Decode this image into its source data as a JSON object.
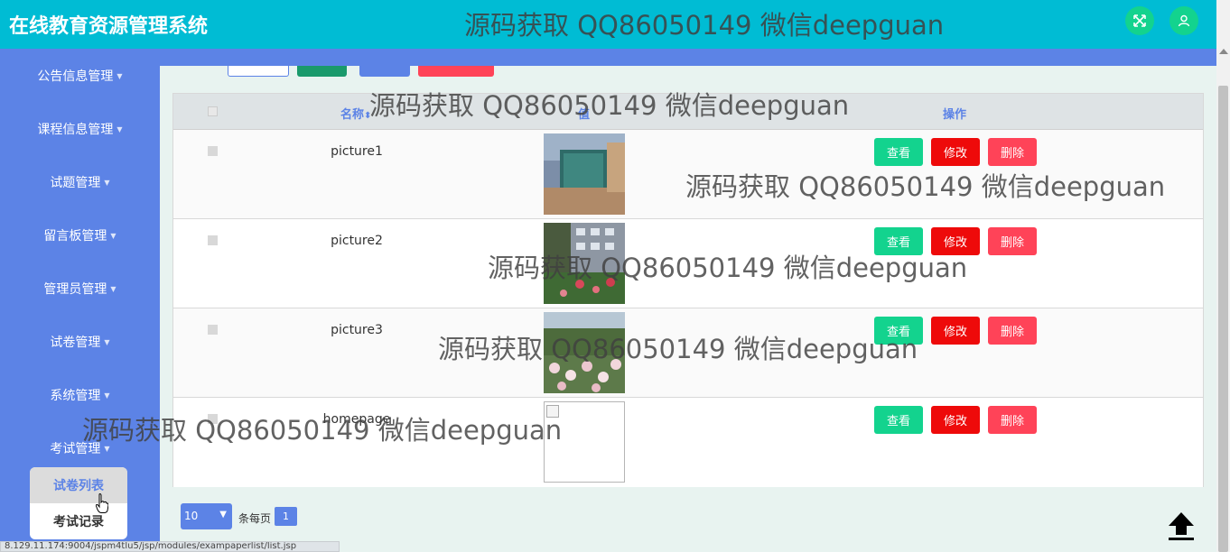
{
  "header": {
    "title": "在线教育资源管理系统",
    "watermark": "源码获取 QQ86050149 微信deepguan",
    "fullscreen_icon": "expand-icon",
    "user_icon": "user-icon"
  },
  "sidebar": {
    "items": [
      {
        "label": "公告信息管理"
      },
      {
        "label": "课程信息管理"
      },
      {
        "label": "试题管理"
      },
      {
        "label": "留言板管理"
      },
      {
        "label": "管理员管理"
      },
      {
        "label": "试卷管理"
      },
      {
        "label": "系统管理"
      },
      {
        "label": "考试管理"
      }
    ],
    "submenu": [
      {
        "label": "试卷列表",
        "active": true
      },
      {
        "label": "考试记录",
        "active": false
      }
    ]
  },
  "table": {
    "headers": {
      "name": "名称",
      "value": "值",
      "actions": "操作"
    },
    "rows": [
      {
        "name": "picture1",
        "image": "photo"
      },
      {
        "name": "picture2",
        "image": "photo"
      },
      {
        "name": "picture3",
        "image": "photo"
      },
      {
        "name": "homepage",
        "image": "broken"
      }
    ],
    "actions": {
      "view": "查看",
      "edit": "修改",
      "delete": "删除"
    }
  },
  "pagination": {
    "page_size": "10",
    "page_size_label": "条每页",
    "current_page": "1"
  },
  "status_bar": {
    "url": "8.129.11.174:9004/jspm4tlu5/jsp/modules/exampaperlist/list.jsp"
  },
  "watermarks": [
    "源码获取 QQ86050149 微信deepguan",
    "源码获取 QQ86050149 微信deepguan",
    "源码获取 QQ86050149 微信deepguan",
    "源码获取 QQ86050149 微信deepguan",
    "源码获取 QQ86050149 微信deepguan"
  ],
  "colors": {
    "header": "#00bcd4",
    "sidebar": "#5c83e6",
    "view": "#13d38e",
    "edit": "#ee0a0a",
    "delete": "#ff4358"
  }
}
